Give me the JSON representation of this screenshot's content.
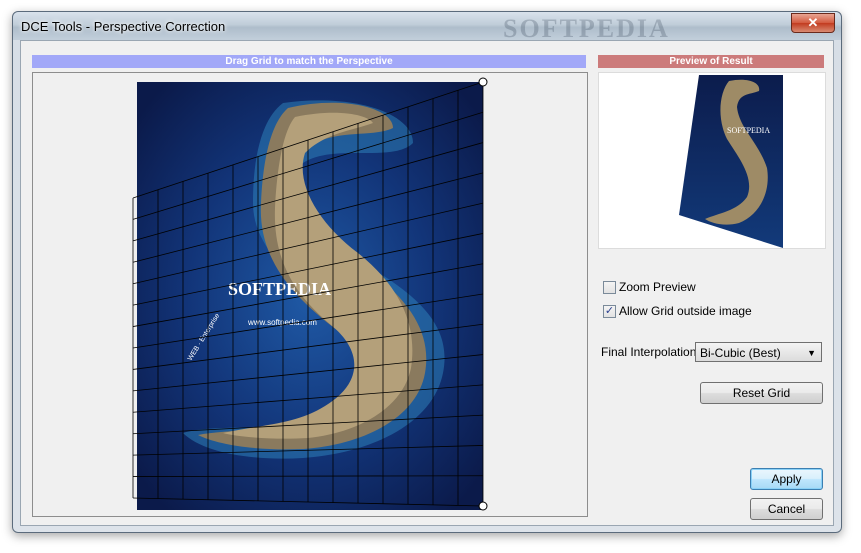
{
  "window": {
    "title": "DCE Tools - Perspective Correction",
    "watermark": "SOFTPEDIA",
    "close_glyph": "✕"
  },
  "panels": {
    "left_header": "Drag Grid to match the Perspective",
    "right_header": "Preview of Result"
  },
  "image": {
    "watermark": "SOFTPEDIA",
    "url_text": "www.softpedia.com",
    "side_text": "WEB · Enterprise"
  },
  "options": {
    "zoom_preview": {
      "label": "Zoom Preview",
      "checked": false
    },
    "allow_grid": {
      "label": "Allow Grid outside image",
      "checked": true,
      "check_glyph": "✓"
    }
  },
  "interpolation": {
    "label": "Final Interpolation",
    "selected": "Bi-Cubic (Best)",
    "arrow_glyph": "▼"
  },
  "buttons": {
    "reset_grid": "Reset Grid",
    "apply": "Apply",
    "cancel": "Cancel"
  },
  "colors": {
    "left_header_bg": "#a2a8f8",
    "right_header_bg": "#cc7b7b",
    "ocean_dark": "#0b1a4a",
    "ocean_light": "#1f5aa6"
  }
}
